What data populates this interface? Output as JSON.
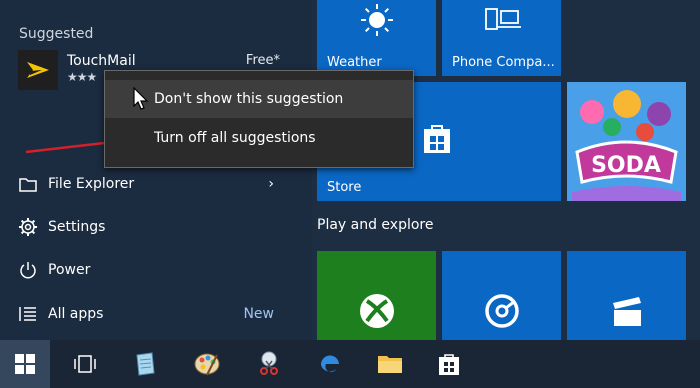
{
  "suggested": {
    "section_label": "Suggested",
    "app": {
      "name": "TouchMail",
      "rating": "★★★",
      "price": "Free*"
    }
  },
  "context_menu": {
    "items": [
      {
        "label": "Don't show this suggestion"
      },
      {
        "label": "Turn off all suggestions"
      }
    ]
  },
  "left_menu": {
    "file_explorer": "File Explorer",
    "settings": "Settings",
    "power": "Power",
    "all_apps": "All apps",
    "all_apps_badge": "New"
  },
  "tiles": {
    "weather": "Weather",
    "phone": "Phone Compa...",
    "store": "Store",
    "group_label": "Play and explore"
  },
  "icons": {
    "touchmail": "touchmail-app-icon",
    "file_explorer": "folder-icon",
    "settings": "gear-icon",
    "power": "power-icon",
    "all_apps": "list-icon",
    "weather": "sun-icon",
    "phone": "phone-laptop-icon",
    "store": "store-bag-icon",
    "xbox": "xbox-icon",
    "groove": "groove-music-icon",
    "movies": "clapperboard-icon"
  },
  "colors": {
    "tile_blue": "#0a67c4",
    "tile_green": "#1e7f1e",
    "accent_text": "#9fc4f0",
    "annotation_arrow": "#d3202a"
  }
}
